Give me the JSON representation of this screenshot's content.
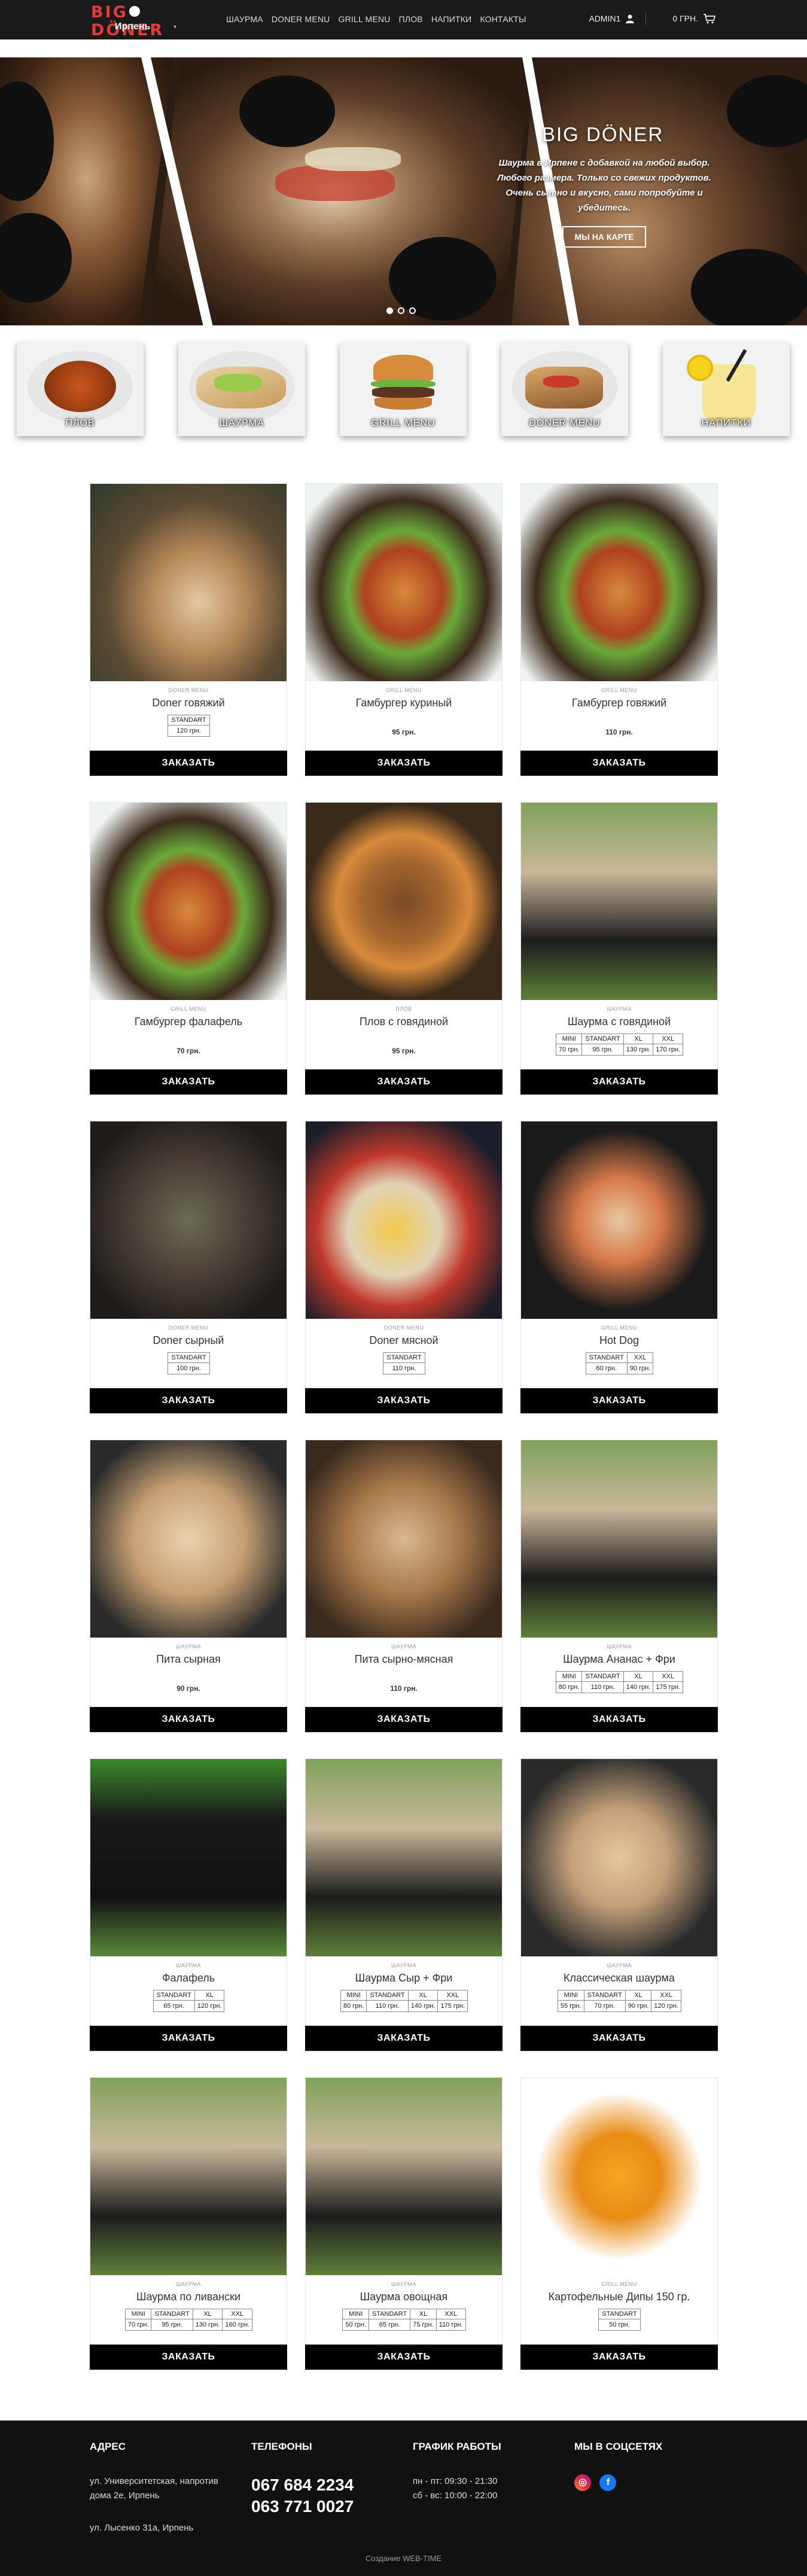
{
  "header": {
    "logo_text_a": "BIG",
    "logo_text_b": "DÖNER",
    "city": "Ирпень",
    "nav": [
      "ШАУРМА",
      "DONER MENU",
      "GRILL MENU",
      "ПЛОВ",
      "НАПИТКИ",
      "КОНТАКТЫ"
    ],
    "account_label": "ADMIN1",
    "cart_label": "0 ГРН."
  },
  "hero": {
    "title": "BIG DÖNER",
    "text": "Шаурма в Ирпене с добавкой на любой выбор. Любого размера. Только со свежих продуктов. Очень сытно и вкусно, сами попробуйте и убедитесь.",
    "button": "МЫ НА КАРТЕ"
  },
  "categories": [
    "ПЛОВ",
    "ШАУРМА",
    "GRILL MENU",
    "DONER MENU",
    "НАПИТКИ"
  ],
  "order_label": "ЗАКАЗАТЬ",
  "products": [
    {
      "cat": "DONER MENU",
      "name": "Doner говяжий",
      "options": [
        {
          "s": "STANDART",
          "p": "120 грн."
        }
      ]
    },
    {
      "cat": "GRILL MENU",
      "name": "Гамбургер куриный",
      "price": "95 грн."
    },
    {
      "cat": "GRILL MENU",
      "name": "Гамбургер говяжий",
      "price": "110 грн."
    },
    {
      "cat": "GRILL MENU",
      "name": "Гамбургер фалафель",
      "price": "70 грн."
    },
    {
      "cat": "ПЛОВ",
      "name": "Плов с говядиной",
      "price": "95 грн."
    },
    {
      "cat": "ШАУРМА",
      "name": "Шаурма с говядиной",
      "options": [
        {
          "s": "MINI",
          "p": "70 грн."
        },
        {
          "s": "STANDART",
          "p": "95 грн."
        },
        {
          "s": "XL",
          "p": "130 грн."
        },
        {
          "s": "XXL",
          "p": "170 грн."
        }
      ]
    },
    {
      "cat": "DONER MENU",
      "name": "Doner сырный",
      "options": [
        {
          "s": "STANDART",
          "p": "100 грн."
        }
      ]
    },
    {
      "cat": "DONER MENU",
      "name": "Doner мясной",
      "options": [
        {
          "s": "STANDART",
          "p": "110 грн."
        }
      ]
    },
    {
      "cat": "GRILL MENU",
      "name": "Hot Dog",
      "options": [
        {
          "s": "STANDART",
          "p": "60 грн."
        },
        {
          "s": "XXL",
          "p": "90 грн."
        }
      ]
    },
    {
      "cat": "ШАУРМА",
      "name": "Пита сырная",
      "price": "90 грн."
    },
    {
      "cat": "ШАУРМА",
      "name": "Пита сырно-мясная",
      "price": "110 грн."
    },
    {
      "cat": "ШАУРМА",
      "name": "Шаурма Ананас + Фри",
      "options": [
        {
          "s": "MINI",
          "p": "80 грн."
        },
        {
          "s": "STANDART",
          "p": "110 грн."
        },
        {
          "s": "XL",
          "p": "140 грн."
        },
        {
          "s": "XXL",
          "p": "175 грн."
        }
      ]
    },
    {
      "cat": "ШАУРМА",
      "name": "Фалафель",
      "options": [
        {
          "s": "STANDART",
          "p": "65 грн."
        },
        {
          "s": "XL",
          "p": "120 грн."
        }
      ]
    },
    {
      "cat": "ШАУРМА",
      "name": "Шаурма Сыр + Фри",
      "options": [
        {
          "s": "MINI",
          "p": "80 грн."
        },
        {
          "s": "STANDART",
          "p": "110 грн."
        },
        {
          "s": "XL",
          "p": "140 грн."
        },
        {
          "s": "XXL",
          "p": "175 грн."
        }
      ]
    },
    {
      "cat": "ШАУРМА",
      "name": "Классическая шаурма",
      "options": [
        {
          "s": "MINI",
          "p": "55 грн."
        },
        {
          "s": "STANDART",
          "p": "70 грн."
        },
        {
          "s": "XL",
          "p": "90 грн."
        },
        {
          "s": "XXL",
          "p": "120 грн."
        }
      ]
    },
    {
      "cat": "ШАУРМА",
      "name": "Шаурма по ливански",
      "options": [
        {
          "s": "MINI",
          "p": "70 грн."
        },
        {
          "s": "STANDART",
          "p": "95 грн."
        },
        {
          "s": "XL",
          "p": "130 грн."
        },
        {
          "s": "XXL",
          "p": "160 грн."
        }
      ]
    },
    {
      "cat": "ШАУРМА",
      "name": "Шаурма овощная",
      "options": [
        {
          "s": "MINI",
          "p": "50 грн."
        },
        {
          "s": "STANDART",
          "p": "65 грн."
        },
        {
          "s": "XL",
          "p": "75 грн."
        },
        {
          "s": "XXL",
          "p": "110 грн."
        }
      ]
    },
    {
      "cat": "GRILL MENU",
      "name": "Картофельные Дипы 150 гр.",
      "options": [
        {
          "s": "STANDART",
          "p": "50 грн."
        }
      ]
    }
  ],
  "footer": {
    "address_title": "АДРЕС",
    "address_1": "ул. Университетская, напротив дома 2е, Ирпень",
    "address_2": "ул. Лысенко 31а, Ирпень",
    "phones_title": "ТЕЛЕФОНЫ",
    "phone_1": "067 684 2234",
    "phone_2": "063 771 0027",
    "hours_title": "ГРАФИК РАБОТЫ",
    "hours_1": "пн - пт: 09:30 - 21:30",
    "hours_2": "сб - вс: 10:00 - 22:00",
    "social_title": "МЫ В СОЦСЕТЯХ",
    "credit": "Создание WEB-TIME"
  },
  "colors": {
    "accent": "#e53935",
    "header_bg": "#1a1a1a",
    "footer_bg": "#111111",
    "button_bg": "#000000"
  }
}
